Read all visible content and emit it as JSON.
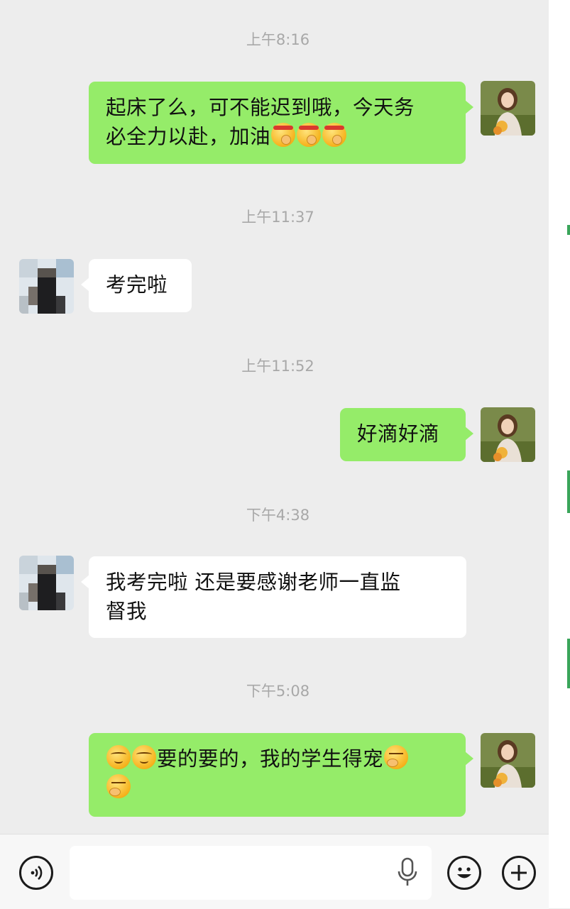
{
  "messages": [
    {
      "type": "time",
      "text": "上午8:16"
    },
    {
      "type": "out",
      "sender": "me",
      "line1": "起床了么，可不能迟到哦，今天务",
      "line2": "必全力以赴，加油",
      "emojis": [
        "fight-emoji",
        "fight-emoji",
        "fight-emoji"
      ]
    },
    {
      "type": "time",
      "text": "上午11:37"
    },
    {
      "type": "in",
      "sender": "student",
      "text": "考完啦"
    },
    {
      "type": "time",
      "text": "上午11:52"
    },
    {
      "type": "out",
      "sender": "me",
      "text": "好滴好滴"
    },
    {
      "type": "time",
      "text": "下午4:38"
    },
    {
      "type": "in",
      "sender": "student",
      "line1": "我考完啦 还是要感谢老师一直监",
      "line2": "督我"
    },
    {
      "type": "time",
      "text": "下午5:08"
    },
    {
      "type": "out",
      "sender": "me",
      "text": "要的要的，我的学生得宠",
      "emojis_before": [
        "blush-emoji",
        "blush-emoji"
      ],
      "emojis_after": [
        "thinking-emoji",
        "thinking-emoji"
      ]
    }
  ],
  "input_bar": {
    "placeholder": "",
    "icons": [
      "voice-mode-icon",
      "microphone-icon",
      "emoji-icon",
      "plus-icon"
    ]
  },
  "colors": {
    "chat_background": "#ededed",
    "outgoing_bubble": "#95ec69",
    "incoming_bubble": "#ffffff",
    "timestamp": "#a8a8a8"
  }
}
